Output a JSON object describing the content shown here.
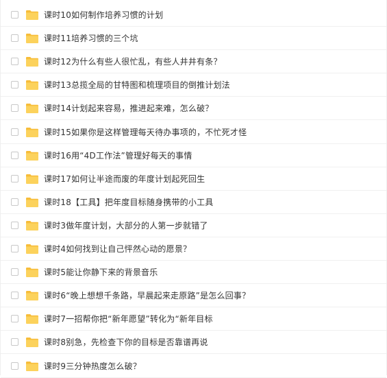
{
  "colors": {
    "folder": "#fcd25c",
    "folder_tab": "#f7bd3a",
    "text": "#333333",
    "divider": "#f0f0f0"
  },
  "icon": "folder-icon",
  "rows": [
    {
      "name": "课时10如何制作培养习惯的计划"
    },
    {
      "name": "课时11培养习惯的三个坑"
    },
    {
      "name": "课时12为什么有些人很忙乱，有些人井井有条？"
    },
    {
      "name": "课时13总揽全局的甘特图和梳理项目的倒推计划法"
    },
    {
      "name": "课时14计划起来容易，推进起来难，怎么破？"
    },
    {
      "name": "课时15如果你是这样管理每天待办事项的，不忙死才怪"
    },
    {
      "name": "课时16用“4D工作法”管理好每天的事情"
    },
    {
      "name": "课时17如何让半途而废的年度计划起死回生"
    },
    {
      "name": "课时18【工具】把年度目标随身携带的小工具"
    },
    {
      "name": "课时3做年度计划，大部分的人第一步就错了"
    },
    {
      "name": "课时4如何找到让自己怦然心动的愿景？"
    },
    {
      "name": "课时5能让你静下来的背景音乐"
    },
    {
      "name": "课时6“晚上想想千条路，早晨起来走原路”是怎么回事？"
    },
    {
      "name": "课时7一招帮你把“新年愿望”转化为“新年目标"
    },
    {
      "name": "课时8别急，先检查下你的目标是否靠谱再说"
    },
    {
      "name": "课时9三分钟热度怎么破？"
    }
  ]
}
